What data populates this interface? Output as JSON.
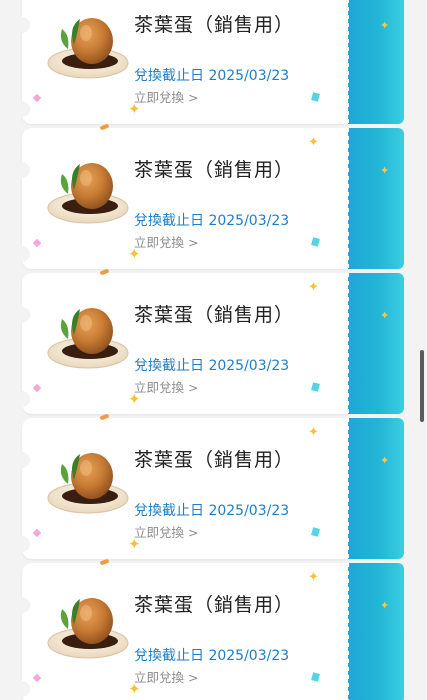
{
  "coupons": [
    {
      "title": "茶葉蛋（銷售用）",
      "expiry": "兌換截止日 2025/03/23",
      "action": "立即兌換 >"
    },
    {
      "title": "茶葉蛋（銷售用）",
      "expiry": "兌換截止日 2025/03/23",
      "action": "立即兌換 >"
    },
    {
      "title": "茶葉蛋（銷售用）",
      "expiry": "兌換截止日 2025/03/23",
      "action": "立即兌換 >"
    },
    {
      "title": "茶葉蛋（銷售用）",
      "expiry": "兌換截止日 2025/03/23",
      "action": "立即兌換 >"
    },
    {
      "title": "茶葉蛋（銷售用）",
      "expiry": "兌換截止日 2025/03/23",
      "action": "立即兌換 >"
    }
  ],
  "icons": {
    "product_image": "tea-egg-icon",
    "sparkle": "sparkle-icon"
  },
  "colors": {
    "stub_gradient_start": "#1fa6d8",
    "stub_gradient_end": "#3ccde0",
    "expiry_text": "#1f7fc6",
    "action_text": "#8c8c8c"
  }
}
